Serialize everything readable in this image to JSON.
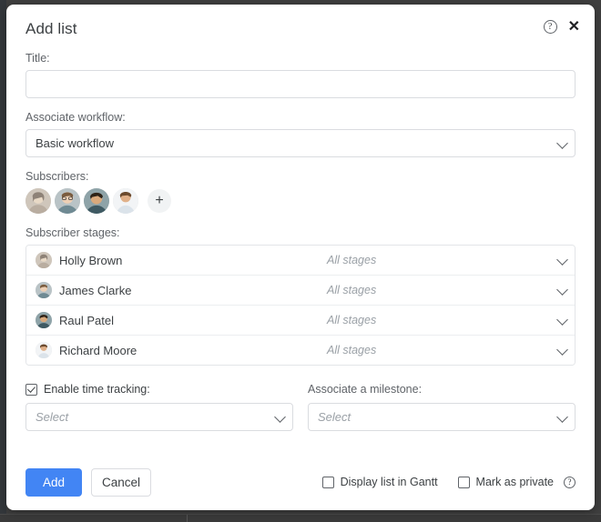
{
  "modal": {
    "title": "Add list",
    "help_icon": "help-circle-icon",
    "close_icon": "close-icon"
  },
  "fields": {
    "title_label": "Title:",
    "title_value": "",
    "title_placeholder": "",
    "workflow_label": "Associate workflow:",
    "workflow_value": "Basic workflow",
    "subscribers_label": "Subscribers:",
    "add_subscriber_glyph": "+",
    "subscriber_stages_label": "Subscriber stages:"
  },
  "subscriber_stages": [
    {
      "name": "Holly Brown",
      "stages": "All stages"
    },
    {
      "name": "James Clarke",
      "stages": "All stages"
    },
    {
      "name": "Raul Patel",
      "stages": "All stages"
    },
    {
      "name": "Richard Moore",
      "stages": "All stages"
    }
  ],
  "options": {
    "time_tracking_label": "Enable time tracking:",
    "time_tracking_checked": true,
    "time_tracking_value": "Select",
    "milestone_label": "Associate a milestone:",
    "milestone_value": "Select"
  },
  "footer": {
    "add_label": "Add",
    "cancel_label": "Cancel",
    "gantt_label": "Display list in Gantt",
    "gantt_checked": false,
    "private_label": "Mark as private",
    "private_checked": false,
    "private_help_icon": "help-circle-icon"
  },
  "colors": {
    "primary": "#4285f4",
    "text": "#3c4043",
    "muted": "#9aa0a6",
    "border": "#dadce0",
    "backdrop": "#3f3f3f"
  }
}
